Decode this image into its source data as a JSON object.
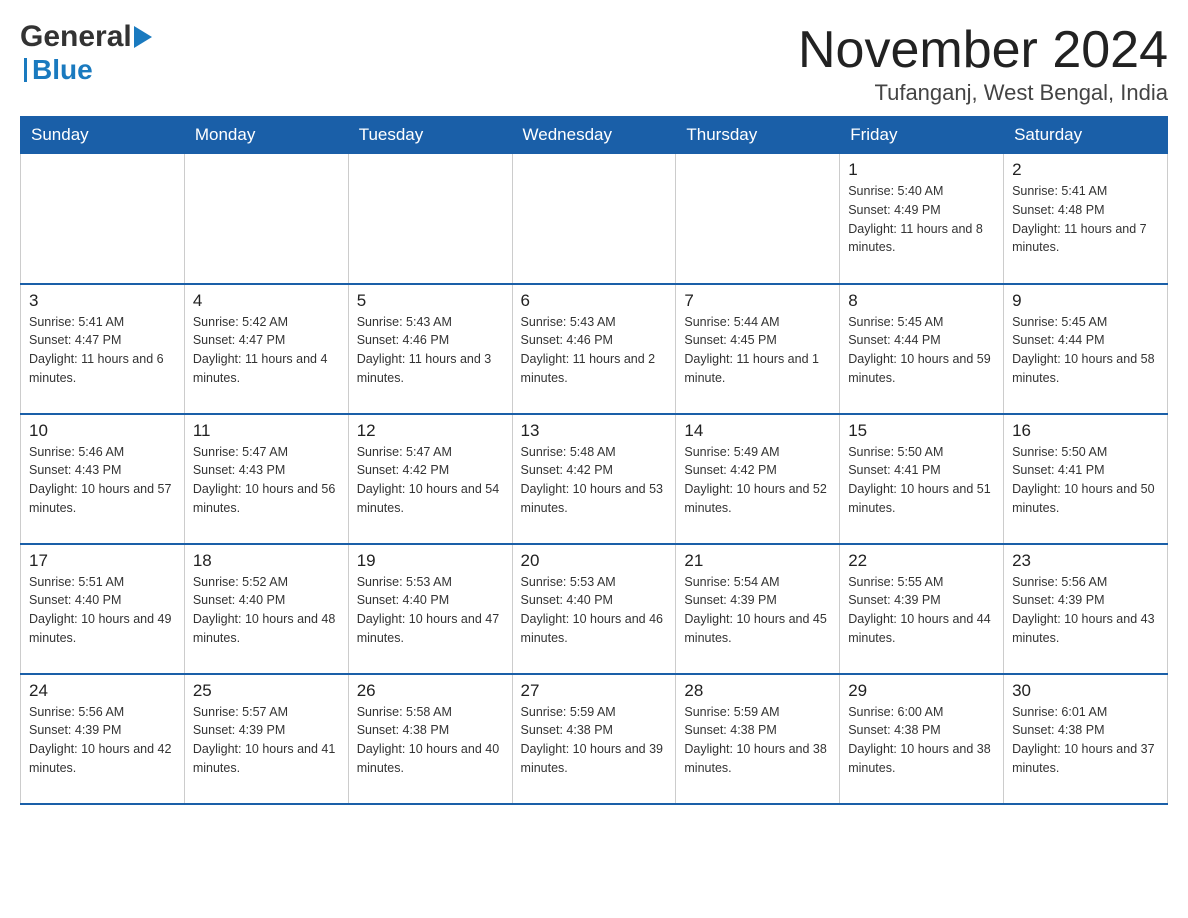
{
  "header": {
    "title": "November 2024",
    "subtitle": "Tufanganj, West Bengal, India"
  },
  "logo": {
    "general": "General",
    "blue": "Blue"
  },
  "days_of_week": [
    "Sunday",
    "Monday",
    "Tuesday",
    "Wednesday",
    "Thursday",
    "Friday",
    "Saturday"
  ],
  "weeks": [
    [
      {
        "day": "",
        "info": ""
      },
      {
        "day": "",
        "info": ""
      },
      {
        "day": "",
        "info": ""
      },
      {
        "day": "",
        "info": ""
      },
      {
        "day": "",
        "info": ""
      },
      {
        "day": "1",
        "info": "Sunrise: 5:40 AM\nSunset: 4:49 PM\nDaylight: 11 hours and 8 minutes."
      },
      {
        "day": "2",
        "info": "Sunrise: 5:41 AM\nSunset: 4:48 PM\nDaylight: 11 hours and 7 minutes."
      }
    ],
    [
      {
        "day": "3",
        "info": "Sunrise: 5:41 AM\nSunset: 4:47 PM\nDaylight: 11 hours and 6 minutes."
      },
      {
        "day": "4",
        "info": "Sunrise: 5:42 AM\nSunset: 4:47 PM\nDaylight: 11 hours and 4 minutes."
      },
      {
        "day": "5",
        "info": "Sunrise: 5:43 AM\nSunset: 4:46 PM\nDaylight: 11 hours and 3 minutes."
      },
      {
        "day": "6",
        "info": "Sunrise: 5:43 AM\nSunset: 4:46 PM\nDaylight: 11 hours and 2 minutes."
      },
      {
        "day": "7",
        "info": "Sunrise: 5:44 AM\nSunset: 4:45 PM\nDaylight: 11 hours and 1 minute."
      },
      {
        "day": "8",
        "info": "Sunrise: 5:45 AM\nSunset: 4:44 PM\nDaylight: 10 hours and 59 minutes."
      },
      {
        "day": "9",
        "info": "Sunrise: 5:45 AM\nSunset: 4:44 PM\nDaylight: 10 hours and 58 minutes."
      }
    ],
    [
      {
        "day": "10",
        "info": "Sunrise: 5:46 AM\nSunset: 4:43 PM\nDaylight: 10 hours and 57 minutes."
      },
      {
        "day": "11",
        "info": "Sunrise: 5:47 AM\nSunset: 4:43 PM\nDaylight: 10 hours and 56 minutes."
      },
      {
        "day": "12",
        "info": "Sunrise: 5:47 AM\nSunset: 4:42 PM\nDaylight: 10 hours and 54 minutes."
      },
      {
        "day": "13",
        "info": "Sunrise: 5:48 AM\nSunset: 4:42 PM\nDaylight: 10 hours and 53 minutes."
      },
      {
        "day": "14",
        "info": "Sunrise: 5:49 AM\nSunset: 4:42 PM\nDaylight: 10 hours and 52 minutes."
      },
      {
        "day": "15",
        "info": "Sunrise: 5:50 AM\nSunset: 4:41 PM\nDaylight: 10 hours and 51 minutes."
      },
      {
        "day": "16",
        "info": "Sunrise: 5:50 AM\nSunset: 4:41 PM\nDaylight: 10 hours and 50 minutes."
      }
    ],
    [
      {
        "day": "17",
        "info": "Sunrise: 5:51 AM\nSunset: 4:40 PM\nDaylight: 10 hours and 49 minutes."
      },
      {
        "day": "18",
        "info": "Sunrise: 5:52 AM\nSunset: 4:40 PM\nDaylight: 10 hours and 48 minutes."
      },
      {
        "day": "19",
        "info": "Sunrise: 5:53 AM\nSunset: 4:40 PM\nDaylight: 10 hours and 47 minutes."
      },
      {
        "day": "20",
        "info": "Sunrise: 5:53 AM\nSunset: 4:40 PM\nDaylight: 10 hours and 46 minutes."
      },
      {
        "day": "21",
        "info": "Sunrise: 5:54 AM\nSunset: 4:39 PM\nDaylight: 10 hours and 45 minutes."
      },
      {
        "day": "22",
        "info": "Sunrise: 5:55 AM\nSunset: 4:39 PM\nDaylight: 10 hours and 44 minutes."
      },
      {
        "day": "23",
        "info": "Sunrise: 5:56 AM\nSunset: 4:39 PM\nDaylight: 10 hours and 43 minutes."
      }
    ],
    [
      {
        "day": "24",
        "info": "Sunrise: 5:56 AM\nSunset: 4:39 PM\nDaylight: 10 hours and 42 minutes."
      },
      {
        "day": "25",
        "info": "Sunrise: 5:57 AM\nSunset: 4:39 PM\nDaylight: 10 hours and 41 minutes."
      },
      {
        "day": "26",
        "info": "Sunrise: 5:58 AM\nSunset: 4:38 PM\nDaylight: 10 hours and 40 minutes."
      },
      {
        "day": "27",
        "info": "Sunrise: 5:59 AM\nSunset: 4:38 PM\nDaylight: 10 hours and 39 minutes."
      },
      {
        "day": "28",
        "info": "Sunrise: 5:59 AM\nSunset: 4:38 PM\nDaylight: 10 hours and 38 minutes."
      },
      {
        "day": "29",
        "info": "Sunrise: 6:00 AM\nSunset: 4:38 PM\nDaylight: 10 hours and 38 minutes."
      },
      {
        "day": "30",
        "info": "Sunrise: 6:01 AM\nSunset: 4:38 PM\nDaylight: 10 hours and 37 minutes."
      }
    ]
  ]
}
